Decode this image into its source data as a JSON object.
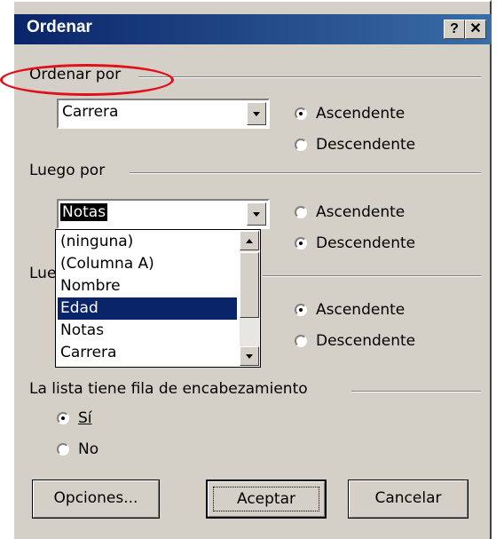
{
  "window": {
    "title": "Ordenar",
    "help_label": "?",
    "close_label": "✕"
  },
  "section1": {
    "label": "Ordenar por",
    "combo_value": "Carrera",
    "radio_asc": "Ascendente",
    "radio_desc": "Descendente",
    "selected": "asc"
  },
  "section2": {
    "label": "Luego por",
    "combo_value": "Notas",
    "radio_asc": "Ascendente",
    "radio_desc": "Descendente",
    "selected": "desc"
  },
  "section3": {
    "label": "Lue",
    "radio_asc": "Ascendente",
    "radio_desc": "Descendente",
    "selected": "asc"
  },
  "dropdown": {
    "items": [
      "(ninguna)",
      "(Columna A)",
      "Nombre",
      "Edad",
      "Notas",
      "Carrera"
    ],
    "highlighted": "Edad"
  },
  "header_row": {
    "label": "La lista tiene fila de encabezamiento",
    "yes": "Sí",
    "no": "No",
    "selected": "yes"
  },
  "buttons": {
    "options": "Opciones...",
    "accept": "Aceptar",
    "cancel": "Cancelar"
  },
  "colors": {
    "title_bg": "#0a246a",
    "dialog_bg": "#d4d0c8",
    "selection": "#0a246a",
    "annotation": "#e0101a"
  }
}
